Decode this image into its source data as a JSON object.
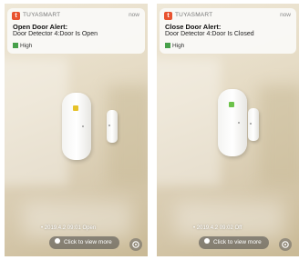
{
  "screens": [
    {
      "app_name": "TUYASMART",
      "time": "now",
      "title": "Open Door Alert:",
      "body": "Door Detector 4:Door Is Open",
      "priority": "High",
      "event_text": "• 2019.4.2 09:01 Open",
      "cta": "Click to view more",
      "led_color": "#e6c229"
    },
    {
      "app_name": "TUYASMART",
      "time": "now",
      "title": "Close Door Alert:",
      "body": "Door Detector 4:Door Is Closed",
      "priority": "High",
      "event_text": "• 2019.4.2 09:02 Off",
      "cta": "Click to view more",
      "led_color": "#6cc24a"
    }
  ],
  "icons": {
    "app": "tuya-app-icon",
    "priority": "green-square-icon",
    "cta": "info-icon",
    "settings": "gear-icon"
  }
}
